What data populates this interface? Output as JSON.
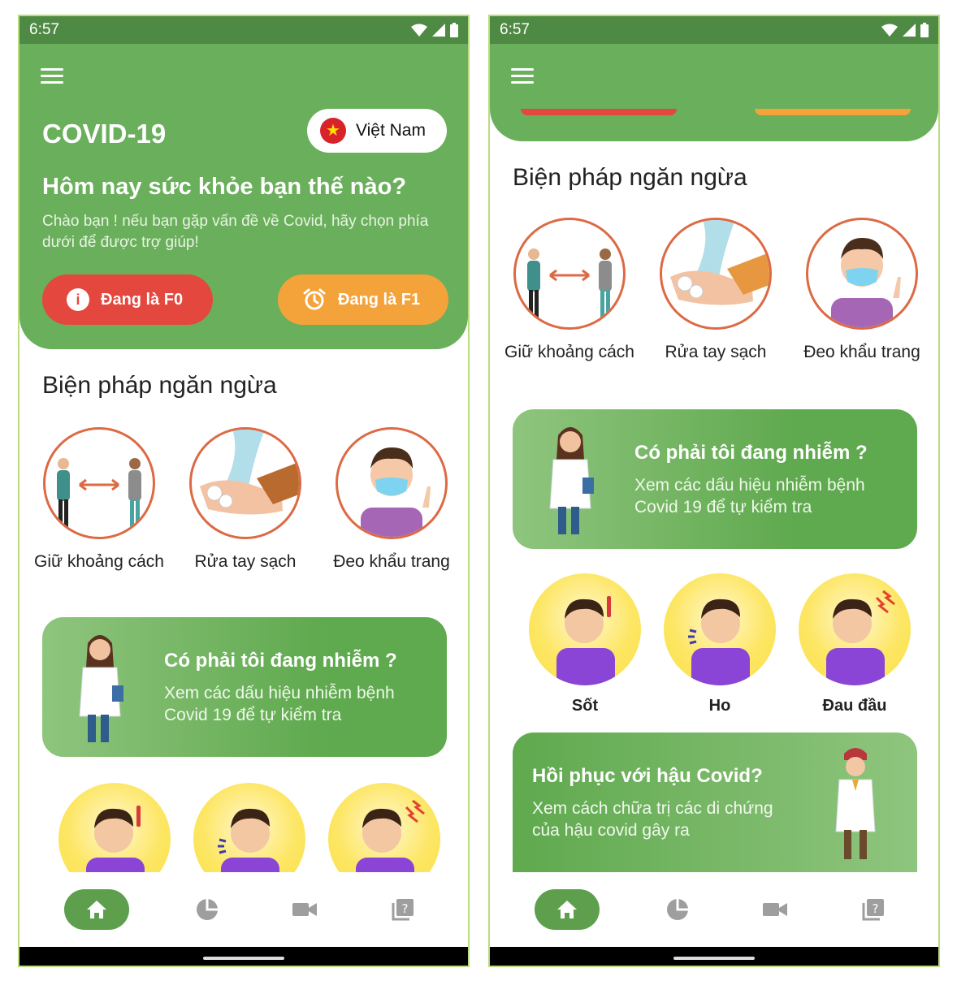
{
  "status_bar": {
    "time": "6:57"
  },
  "header": {
    "app_title": "COVID-19",
    "country": "Việt Nam",
    "greeting": "Hôm nay sức khỏe bạn thế nào?",
    "subtitle": "Chào bạn ! nếu bạn gặp vấn đề về Covid, hãy chọn phía dưới để được trợ giúp!",
    "btn_f0": "Đang là F0",
    "btn_f1": "Đang là F1"
  },
  "prevention": {
    "title": "Biện pháp ngăn ngừa",
    "items": [
      {
        "label": "Giữ khoảng cách"
      },
      {
        "label": "Rửa tay sạch"
      },
      {
        "label": "Đeo khẩu trang"
      }
    ]
  },
  "infection_card": {
    "left_title": "Có phải tôi đang nhiễm ?",
    "left_sub": "Xem các dấu hiệu nhiễm bệnh Covid 19 để tự kiểm tra",
    "right_title": "Có phải tôi đang nhiễm ?",
    "right_sub": "Xem các dấu hiệu nhiễm bệnh Covid 19 để tự kiểm tra"
  },
  "symptoms": {
    "items": [
      {
        "label": "Sốt"
      },
      {
        "label": "Ho"
      },
      {
        "label": "Đau đầu"
      }
    ]
  },
  "recovery_card": {
    "title": "Hồi phục với hậu Covid?",
    "sub": "Xem cách chữa trị các di chứng của hậu covid gây ra"
  },
  "bottom_nav": {
    "items": [
      "home-icon",
      "chart-icon",
      "video-icon",
      "quiz-icon"
    ]
  },
  "colors": {
    "primary_green": "#6aaf5b",
    "f0_red": "#e4473d",
    "f1_orange": "#f3a33a"
  }
}
